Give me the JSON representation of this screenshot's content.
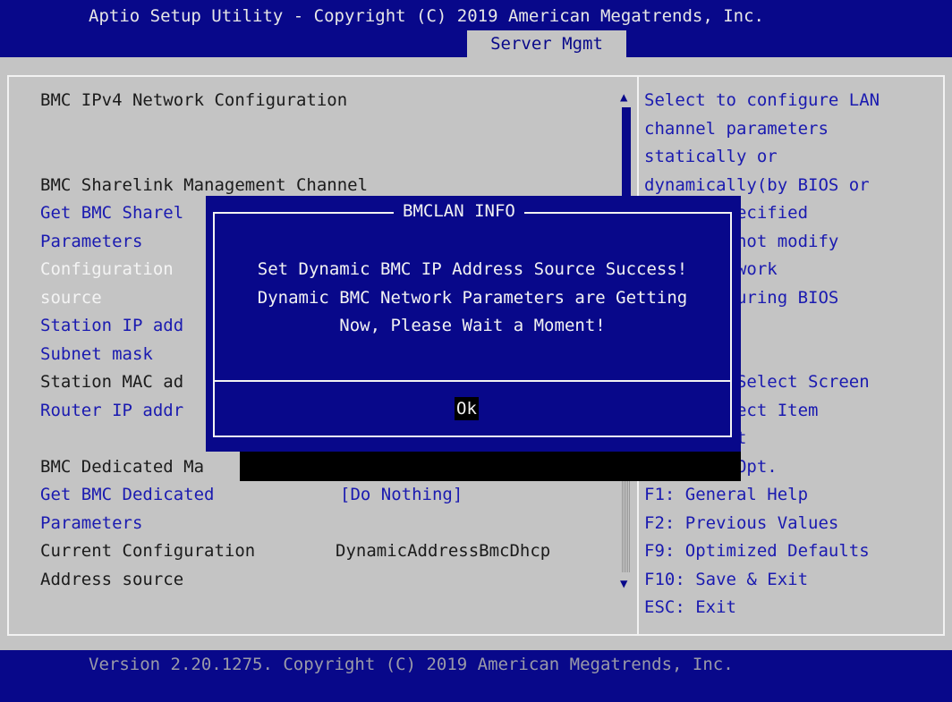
{
  "header": {
    "title": "Aptio Setup Utility - Copyright (C) 2019 American Megatrends, Inc.",
    "active_tab": "Server Mgmt"
  },
  "settings": {
    "section_title": "BMC IPv4 Network Configuration",
    "sharelink_heading": "BMC Sharelink Management Channel",
    "get_sharelink_1": "Get BMC Sharel",
    "get_sharelink_2": "Parameters",
    "config_source_1": "Configuration",
    "config_source_2": "source",
    "station_ip": "Station IP add",
    "subnet_mask": "Subnet mask",
    "station_mac": "Station MAC ad",
    "router_ip": "Router IP addr",
    "dedicated_heading": "BMC Dedicated Ma",
    "get_dedicated_1": "Get BMC Dedicated",
    "get_dedicated_2": "Parameters",
    "get_dedicated_value": "[Do Nothing]",
    "current_config_1": "Current Configuration",
    "current_config_2": "Address source",
    "current_config_value": "DynamicAddressBmcDhcp"
  },
  "help": {
    "lines": [
      "Select to configure LAN",
      "channel parameters",
      "statically or",
      "dynamically(by BIOS or",
      "       specified",
      "       l not modify",
      "        twork",
      "        during BIOS"
    ]
  },
  "keys": {
    "lines": [
      "       : Select Screen",
      "       elect Item",
      "       ect",
      "       e Opt.",
      "F1: General Help",
      "F2: Previous Values",
      "F9: Optimized Defaults",
      "F10: Save & Exit",
      "ESC: Exit"
    ]
  },
  "dialog": {
    "title": "BMCLAN INFO",
    "line1": "Set Dynamic BMC IP Address Source Success!",
    "line2": "Dynamic BMC Network Parameters are Getting",
    "line3": "Now, Please Wait a Moment!",
    "ok_label": "Ok"
  },
  "footer": {
    "version": "Version 2.20.1275. Copyright (C) 2019 American Megatrends, Inc."
  },
  "colors": {
    "bios_blue": "#08088a",
    "background": "#c4c4c4",
    "item_blue": "#1a1ab0"
  }
}
